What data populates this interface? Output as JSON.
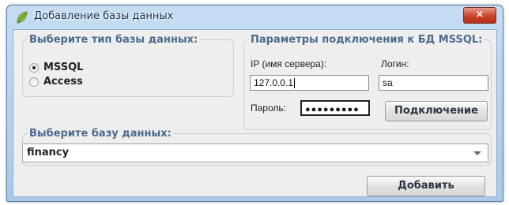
{
  "window": {
    "title": "Добавление базы данных",
    "close_label": "×"
  },
  "db_type": {
    "legend": "Выберите тип базы данных:",
    "options": [
      {
        "label": "MSSQL",
        "selected": true
      },
      {
        "label": "Access",
        "selected": false
      }
    ]
  },
  "connection": {
    "legend": "Параметры подключения к БД MSSQL:",
    "server_label": "IP (имя сервера):",
    "server_value": "127.0.0.1",
    "login_label": "Логин:",
    "login_value": "sa",
    "password_label": "Пароль:",
    "password_mask": "●●●●●●●●●",
    "connect_button": "Подключение"
  },
  "database": {
    "legend": "Выберите базу данных:",
    "selected": "financy"
  },
  "add_button": "Добавить",
  "colors": {
    "accent": "#4d6a8c",
    "titlebar": "#b9d3f0",
    "close": "#c8422b"
  }
}
